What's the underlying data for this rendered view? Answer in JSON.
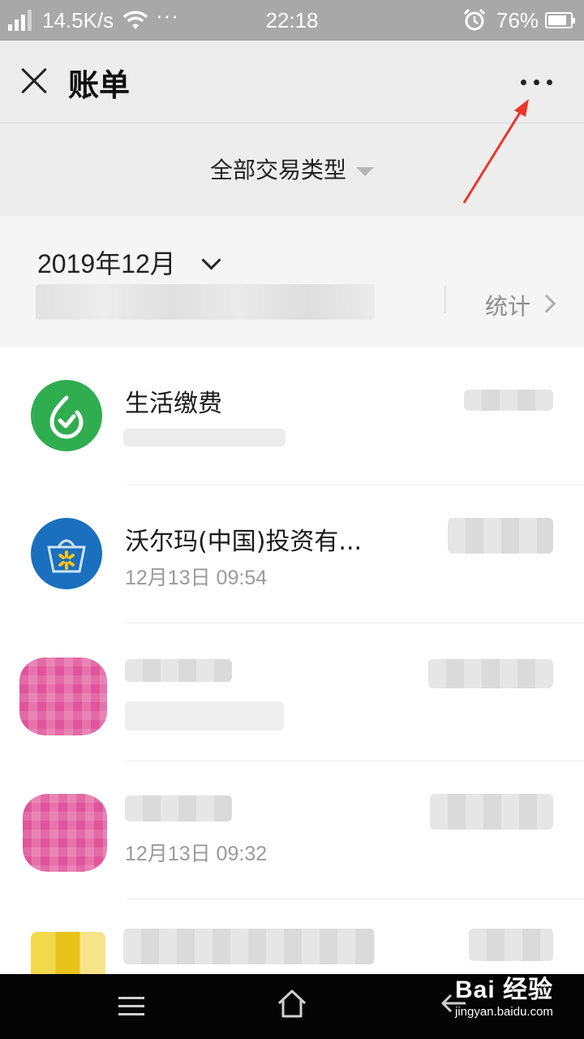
{
  "status_bar": {
    "net_speed": "14.5K/s",
    "more": "···",
    "time": "22:18",
    "battery_pct": "76%"
  },
  "header": {
    "title": "账单",
    "close_icon": "close-icon",
    "more_icon": "more-horizontal-icon"
  },
  "filter": {
    "label": "全部交易类型"
  },
  "summary": {
    "month": "2019年12月",
    "stats_label": "统计"
  },
  "transactions": [
    {
      "name": "生活缴费",
      "time": "",
      "avatar": "utility-green",
      "avatar_color": "#2fad4f"
    },
    {
      "name": "沃尔玛(中国)投资有...",
      "time": "12月13日 09:54",
      "avatar": "walmart-blue",
      "avatar_color": "#1a6fbf"
    },
    {
      "name": "",
      "time": "",
      "avatar": "pixelated-pink",
      "avatar_color": "#e0559a"
    },
    {
      "name": "",
      "time": "12月13日 09:32",
      "avatar": "pixelated-pink",
      "avatar_color": "#e0559a"
    },
    {
      "name": "",
      "time": "",
      "avatar": "pixelated-yellow",
      "avatar_color": "#e9c21c"
    }
  ],
  "watermark": {
    "logo": "Bai 经验",
    "url": "jingyan.baidu.com"
  },
  "colors": {
    "nav_bg": "#ededed",
    "status_bg": "#a8a8a8",
    "annotation_arrow": "#e8372c"
  }
}
